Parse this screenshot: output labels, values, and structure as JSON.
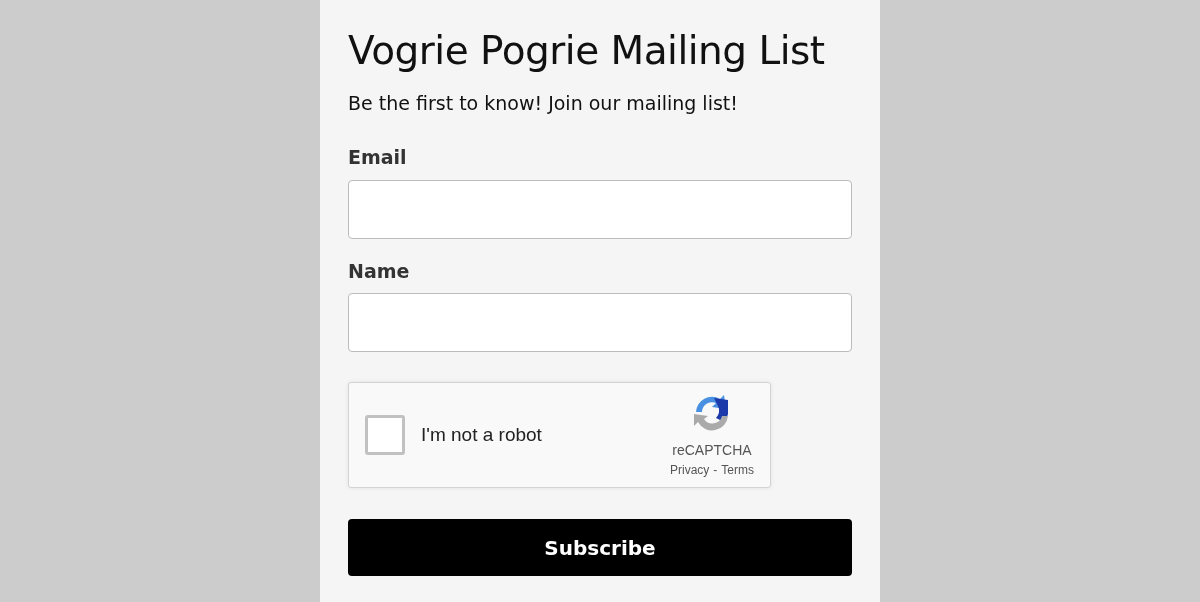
{
  "title": "Vogrie Pogrie Mailing List",
  "subtitle": "Be the first to know! Join our mailing list!",
  "fields": [
    {
      "label": "Email"
    },
    {
      "label": "Name"
    }
  ],
  "captcha": {
    "label": "I'm not a robot",
    "checked": false,
    "brand": "reCAPTCHA",
    "links": [
      "Privacy",
      "Terms"
    ],
    "separator": "-"
  },
  "submit": "Subscribe"
}
